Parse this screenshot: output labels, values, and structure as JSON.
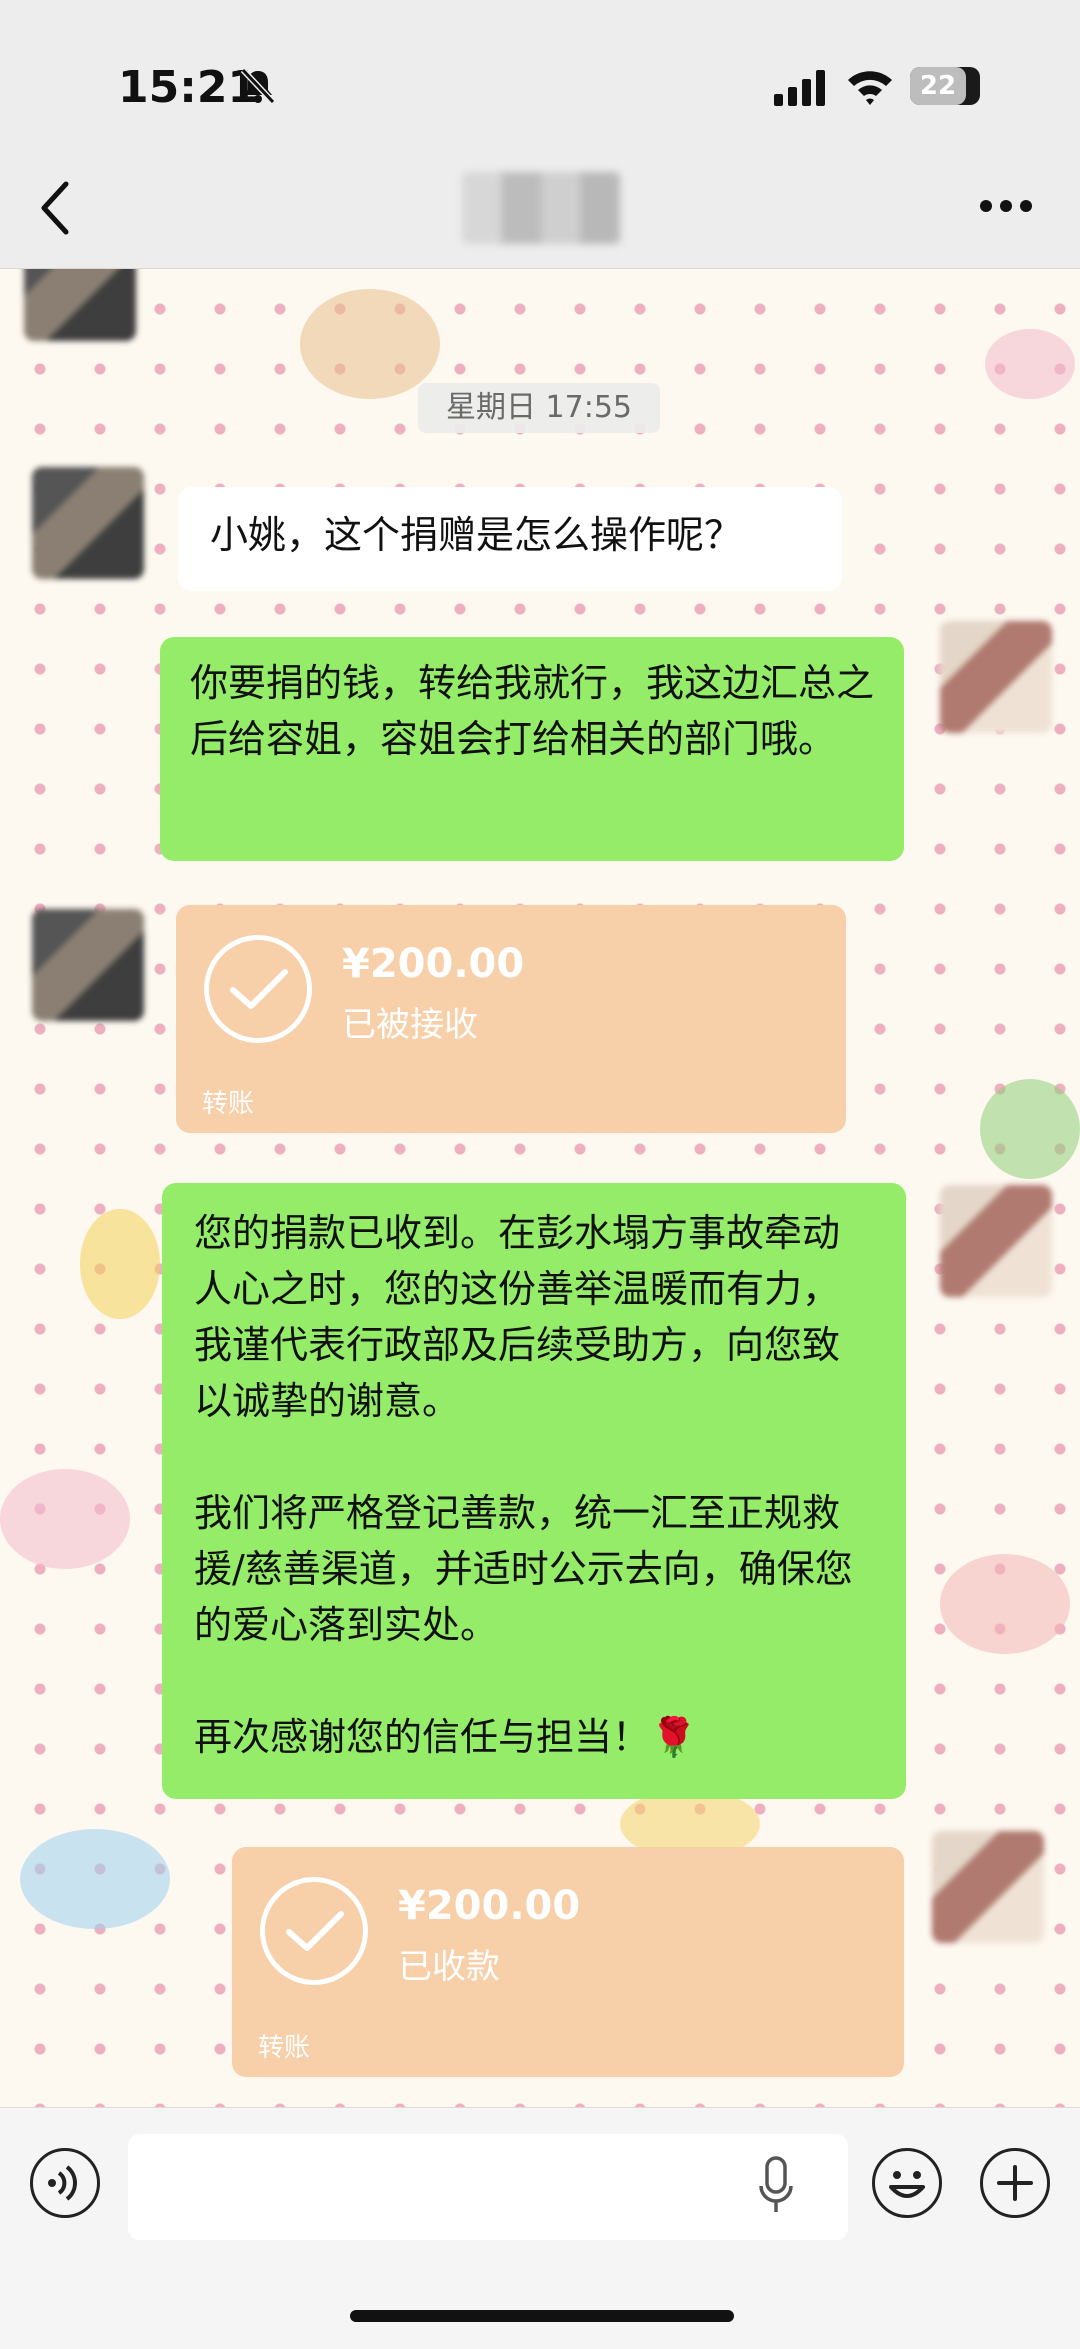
{
  "status_bar": {
    "time": "15:21",
    "battery": "22"
  },
  "chat": {
    "timestamp": "星期日 17:55",
    "messages": [
      {
        "side": "left",
        "type": "text",
        "text": "小姚，这个捐赠是怎么操作呢？"
      },
      {
        "side": "right",
        "type": "text",
        "text": "你要捐的钱，转给我就行，我这边汇总之后给容姐，容姐会打给相关的部门哦。"
      },
      {
        "side": "left",
        "type": "transfer",
        "amount": "¥200.00",
        "status": "已被接收",
        "label": "转账"
      },
      {
        "side": "right",
        "type": "text",
        "text": "您的捐款已收到。在彭水塌方事故牵动人心之时，您的这份善举温暖而有力，我谨代表行政部及后续受助方，向您致以诚挚的谢意。\n\n我们将严格登记善款，统一汇至正规救援/慈善渠道，并适时公示去向，确保您的爱心落到实处。\n\n再次感谢您的信任与担当！🌹"
      },
      {
        "side": "right",
        "type": "transfer",
        "amount": "¥200.00",
        "status": "已收款",
        "label": "转账"
      }
    ]
  },
  "colors": {
    "green_bubble": "#95ec69",
    "transfer_bg": "#f7cfa8",
    "topbar_bg": "#ededed"
  },
  "icons": [
    "back-icon",
    "more-icon",
    "voice-icon",
    "mic-icon",
    "emoji-icon",
    "plus-icon",
    "check-icon"
  ]
}
